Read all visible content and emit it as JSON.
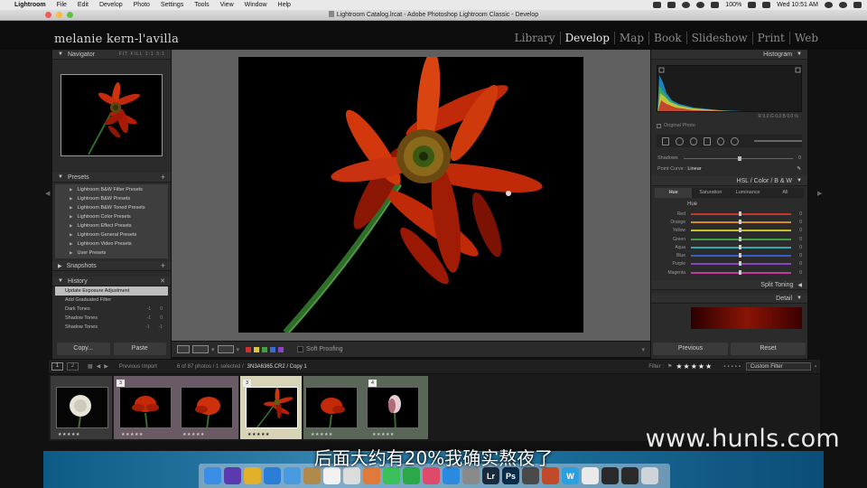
{
  "menubar": {
    "app": "Lightroom",
    "items": [
      "File",
      "Edit",
      "Develop",
      "Photo",
      "Settings",
      "Tools",
      "View",
      "Window",
      "Help"
    ],
    "battery": "100%",
    "clock": "Wed 10:51 AM"
  },
  "window": {
    "title": "Lightroom Catalog.lrcat - Adobe Photoshop Lightroom Classic - Develop"
  },
  "identity_plate": "melanie kern-l'avilla",
  "modules": [
    {
      "label": "Library",
      "active": false
    },
    {
      "label": "Develop",
      "active": true
    },
    {
      "label": "Map",
      "active": false
    },
    {
      "label": "Book",
      "active": false
    },
    {
      "label": "Slideshow",
      "active": false
    },
    {
      "label": "Print",
      "active": false
    },
    {
      "label": "Web",
      "active": false
    }
  ],
  "left": {
    "navigator": {
      "title": "Navigator",
      "zoom": "FIT  FILL  1:1  3:1"
    },
    "presets": {
      "title": "Presets",
      "items": [
        "Lightroom B&W Filter Presets",
        "Lightroom B&W Presets",
        "Lightroom B&W Toned Presets",
        "Lightroom Color Presets",
        "Lightroom Effect Presets",
        "Lightroom General Presets",
        "Lightroom Video Presets",
        "User Presets"
      ]
    },
    "snapshots": {
      "title": "Snapshots"
    },
    "history": {
      "title": "History",
      "items": [
        {
          "label": "Update Exposure Adjustment",
          "a": "",
          "b": ""
        },
        {
          "label": "Add Graduated Filter",
          "a": "",
          "b": ""
        },
        {
          "label": "Dark Tones",
          "a": "-1",
          "b": "0"
        },
        {
          "label": "Shadow Tones",
          "a": "-1",
          "b": "0"
        },
        {
          "label": "Shadow Tones",
          "a": "-1",
          "b": "-1"
        }
      ]
    },
    "copy_label": "Copy...",
    "paste_label": "Paste"
  },
  "toolbar": {
    "soft_proofing": "Soft Proofing"
  },
  "right": {
    "histogram_title": "Histogram",
    "histo_values": "R  0.0  G  0.0  B  0.0 %",
    "original_photo": "Original Photo",
    "shadows_label": "Shadows",
    "shadows_value": "0",
    "point_curve_label": "Point Curve :",
    "point_curve_value": "Linear",
    "hsl_header": "HSL  /  Color  /  B & W",
    "hsl_tabs": [
      "Hue",
      "Saturation",
      "Luminance",
      "All"
    ],
    "hue_label": "Hue",
    "hsl_rows": [
      {
        "label": "Red",
        "value": "0",
        "color": "#c0392b"
      },
      {
        "label": "Orange",
        "value": "0",
        "color": "#d68a2c"
      },
      {
        "label": "Yellow",
        "value": "0",
        "color": "#c9c02a"
      },
      {
        "label": "Green",
        "value": "0",
        "color": "#3ea043"
      },
      {
        "label": "Aqua",
        "value": "0",
        "color": "#2eaab0"
      },
      {
        "label": "Blue",
        "value": "0",
        "color": "#3a5cc8"
      },
      {
        "label": "Purple",
        "value": "0",
        "color": "#8a44c0"
      },
      {
        "label": "Magenta",
        "value": "0",
        "color": "#c43a9a"
      }
    ],
    "split_toning_title": "Split Toning",
    "detail_title": "Detail",
    "previous_label": "Previous",
    "reset_label": "Reset"
  },
  "filmbar": {
    "page1": "1",
    "page2": "2",
    "source": "Previous Import",
    "count": "6 of 87 photos / 1 selected /",
    "file": "3N3A6365.CR2 / Copy 1",
    "filter_label": "Filter :",
    "stars": "★★★★★",
    "custom_filter": "Custom Filter"
  },
  "filmstrip": [
    {
      "num": "",
      "stars": "★★★★★"
    },
    {
      "num": "3",
      "stars": "★★★★★"
    },
    {
      "num": "",
      "stars": "★★★★★"
    },
    {
      "num": "3",
      "stars": "★★★★★"
    },
    {
      "num": "",
      "stars": "★★★★★"
    },
    {
      "num": "4",
      "stars": "★★★★★"
    }
  ],
  "watermark": "www.hunls.com",
  "subtitle": "后面大约有20%我确实熬夜了",
  "dock": [
    {
      "name": "finder-icon",
      "color": "#3a8ee6",
      "glyph": ""
    },
    {
      "name": "siri-icon",
      "color": "#5b3ab0",
      "glyph": ""
    },
    {
      "name": "chrome-icon",
      "color": "#e3b02a",
      "glyph": ""
    },
    {
      "name": "safari-icon",
      "color": "#2a7ed8",
      "glyph": ""
    },
    {
      "name": "mail-icon",
      "color": "#4a9ae0",
      "glyph": ""
    },
    {
      "name": "notes-icon",
      "color": "#b08a4a",
      "glyph": ""
    },
    {
      "name": "calendar-icon",
      "color": "#f2f2f2",
      "glyph": ""
    },
    {
      "name": "reminders-icon",
      "color": "#dcdcdc",
      "glyph": ""
    },
    {
      "name": "photos-icon",
      "color": "#e07a3a",
      "glyph": ""
    },
    {
      "name": "messages-icon",
      "color": "#3ac05a",
      "glyph": ""
    },
    {
      "name": "facetime-icon",
      "color": "#2aa84a",
      "glyph": ""
    },
    {
      "name": "music-icon",
      "color": "#e04a6a",
      "glyph": ""
    },
    {
      "name": "appstore-icon",
      "color": "#2a8ae0",
      "glyph": ""
    },
    {
      "name": "settings-icon",
      "color": "#8a8a8a",
      "glyph": ""
    },
    {
      "name": "lightroom-icon",
      "color": "#1a2a3a",
      "glyph": "Lr"
    },
    {
      "name": "photoshop-icon",
      "color": "#0a2a4a",
      "glyph": "Ps"
    },
    {
      "name": "vpn-icon",
      "color": "#4a4a4a",
      "glyph": ""
    },
    {
      "name": "launcher-icon",
      "color": "#c04a2a",
      "glyph": ""
    },
    {
      "name": "webstorm-icon",
      "color": "#2aa0e0",
      "glyph": "W"
    },
    {
      "name": "document-icon",
      "color": "#eaeaea",
      "glyph": ""
    },
    {
      "name": "folder-icon",
      "color": "#2a2a2a",
      "glyph": ""
    },
    {
      "name": "folder2-icon",
      "color": "#2a2a2a",
      "glyph": ""
    },
    {
      "name": "trash-icon",
      "color": "#cfd4da",
      "glyph": ""
    }
  ]
}
